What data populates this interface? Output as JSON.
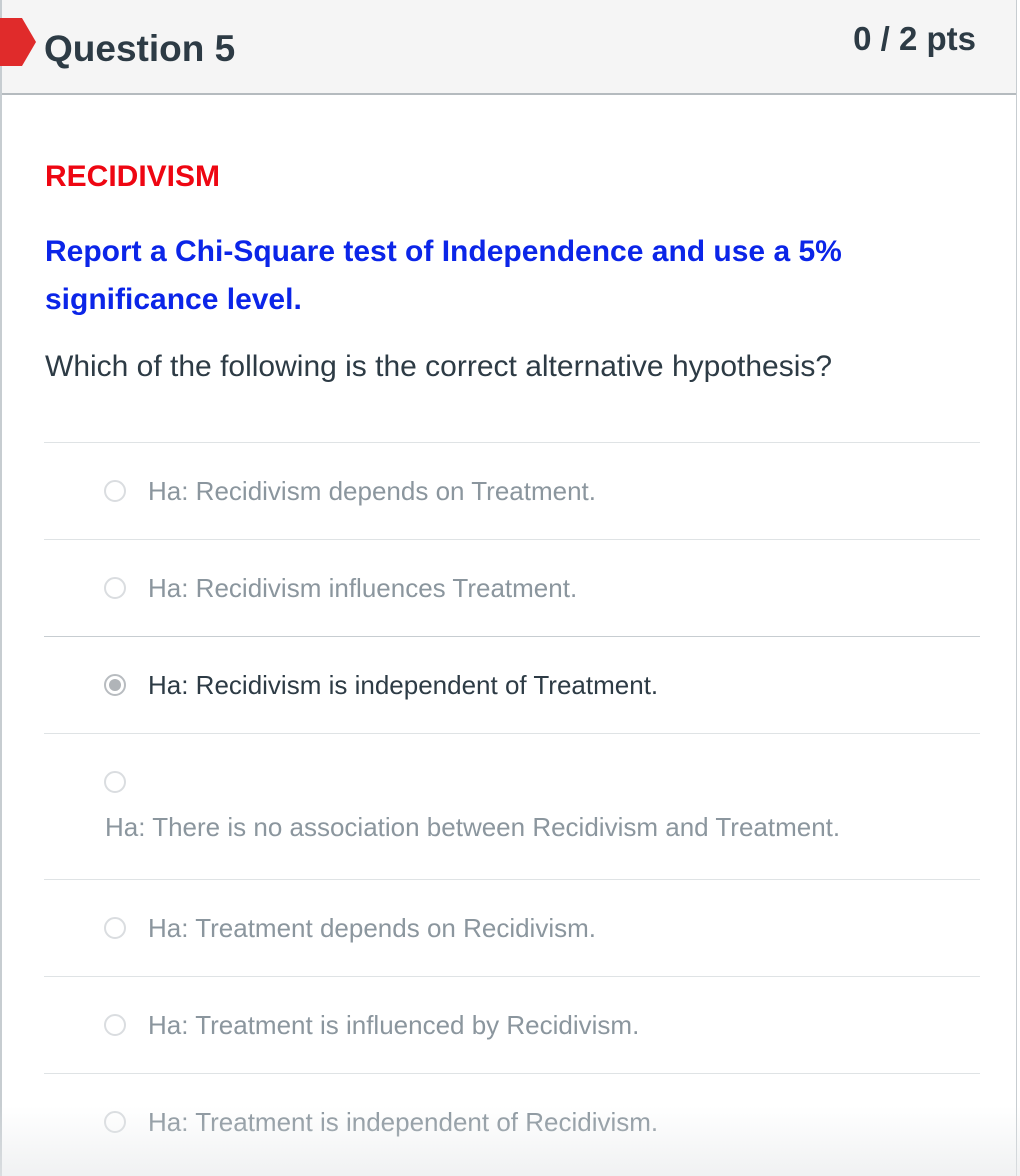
{
  "question": {
    "title": "Question 5",
    "points": "0 / 2 pts",
    "flag_color": "#e02b2b"
  },
  "body": {
    "topic": "RECIDIVISM",
    "topic_color": "#ee0612",
    "instruction": "Report a Chi-Square test of Independence and use a 5% significance level.",
    "instruction_color": "#0b25e8",
    "prompt": "Which of the following is the correct alternative hypothesis?"
  },
  "answers": [
    {
      "label": "Ha: Recidivism depends on Treatment.",
      "selected": false
    },
    {
      "label": "Ha: Recidivism influences Treatment.",
      "selected": false
    },
    {
      "label": "Ha: Recidivism is independent of Treatment.",
      "selected": true
    },
    {
      "label": "Ha: There is no association between Recidivism and Treatment.",
      "selected": false
    },
    {
      "label": "Ha: Treatment depends on Recidivism.",
      "selected": false
    },
    {
      "label": "Ha: Treatment is influenced by Recidivism.",
      "selected": false
    },
    {
      "label": "Ha: Treatment is independent of Recidivism.",
      "selected": false
    }
  ]
}
